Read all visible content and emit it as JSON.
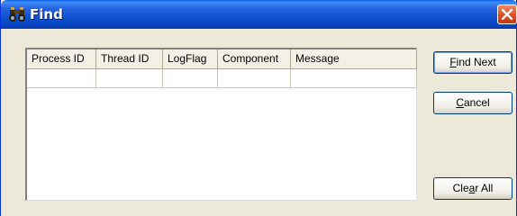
{
  "window": {
    "title": "Find",
    "title_icon": "binoculars-icon",
    "close_icon": "close-icon"
  },
  "table": {
    "columns": [
      "Process ID",
      "Thread ID",
      "LogFlag",
      "Component",
      "Message"
    ],
    "rows": [
      [
        "",
        "",
        "",
        "",
        ""
      ]
    ]
  },
  "buttons": {
    "find_next": {
      "prefix": "",
      "mnemonic": "F",
      "suffix": "ind Next"
    },
    "cancel": {
      "prefix": "",
      "mnemonic": "C",
      "suffix": "ancel"
    },
    "clear_all": {
      "prefix": "Cle",
      "mnemonic": "a",
      "suffix": "r All"
    }
  },
  "colors": {
    "titlebar": "#0b4ccb",
    "close": "#d9481f",
    "face": "#ece9d8"
  }
}
